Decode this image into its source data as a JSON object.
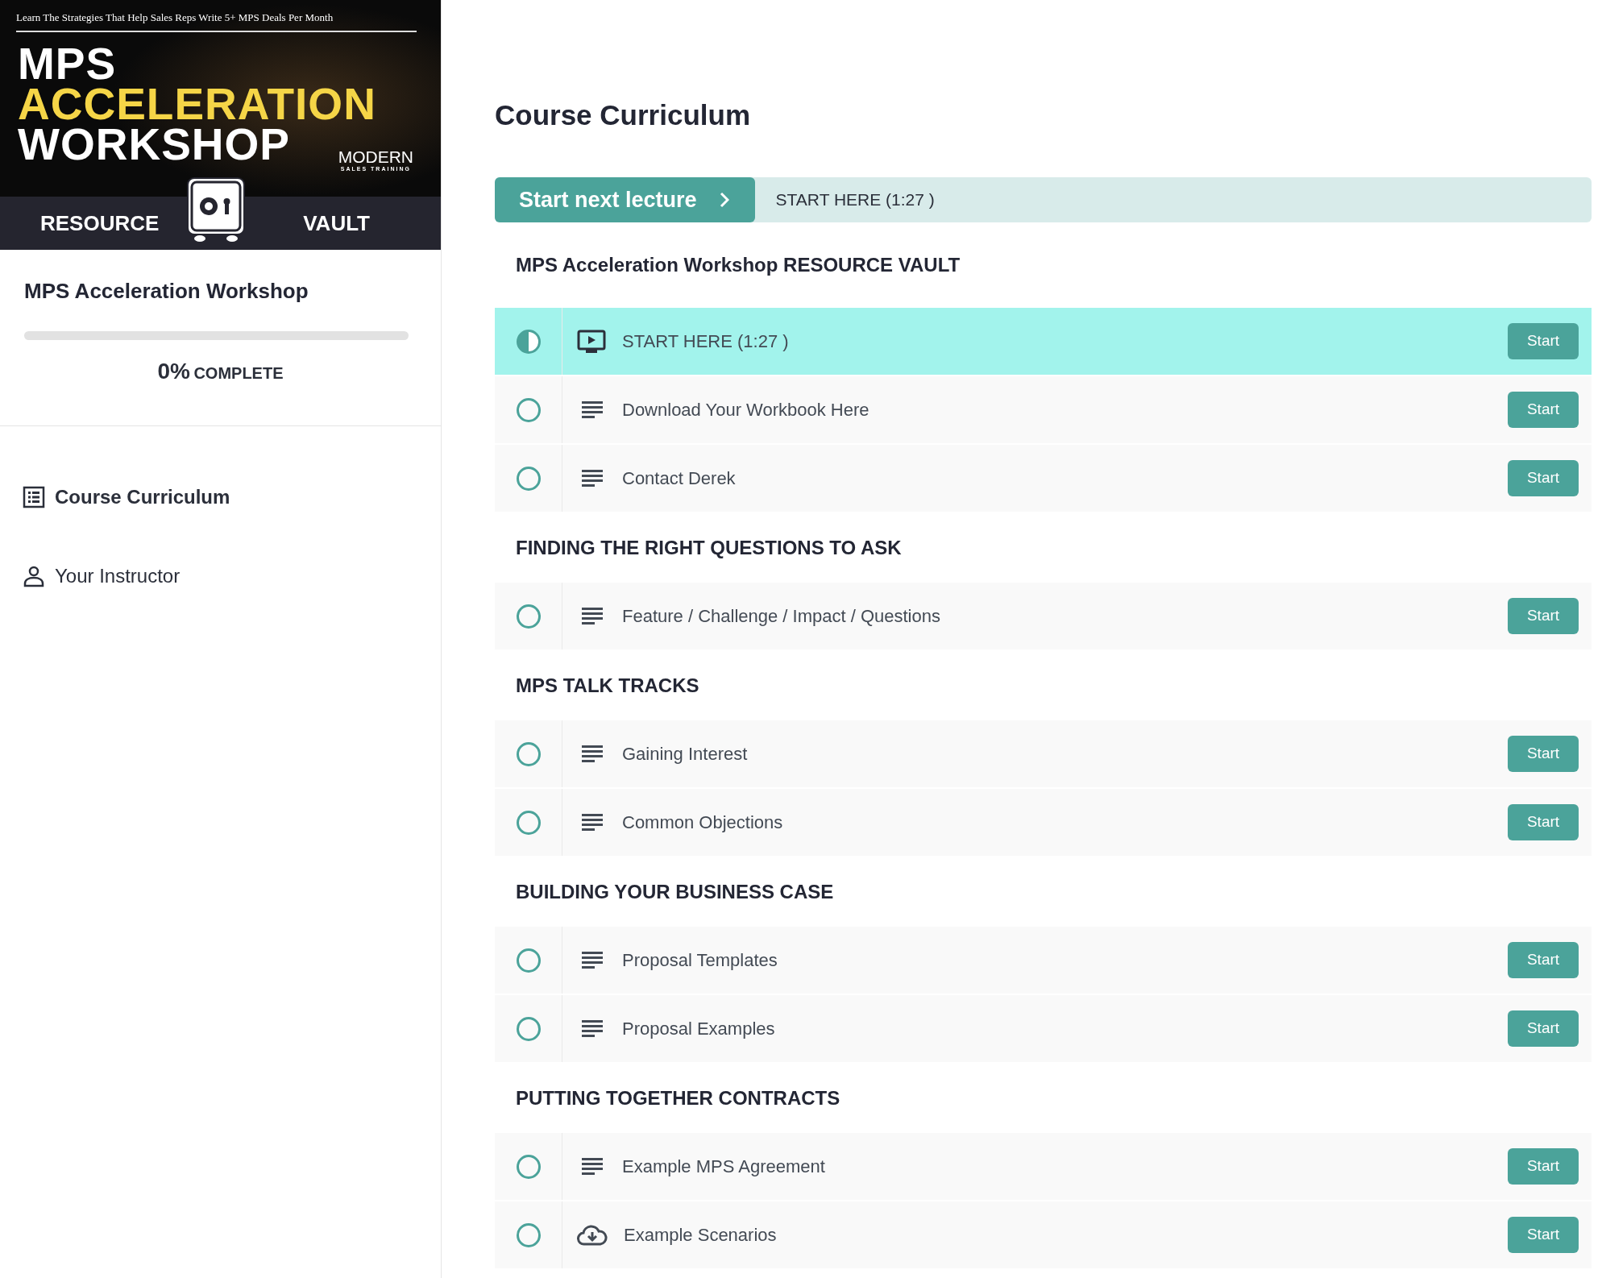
{
  "banner": {
    "tagline": "Learn The Strategies That Help Sales Reps Write 5+ MPS Deals Per Month",
    "title_lines": [
      {
        "text": "MPS",
        "color": "#ffffff"
      },
      {
        "text": "ACCELERATION",
        "color": "#f5d547"
      },
      {
        "text": "WORKSHOP",
        "color": "#ffffff"
      }
    ],
    "brand": "MODERN",
    "brand_sub": "SALES TRAINING",
    "left_word": "RESOURCE",
    "right_word": "VAULT"
  },
  "sidebar": {
    "course_title": "MPS Acceleration Workshop",
    "progress": {
      "level": 0,
      "percent": "0%",
      "label": "COMPLETE"
    },
    "items": [
      {
        "label": "Course Curriculum",
        "kind": "curriculum",
        "selected": true
      },
      {
        "label": "Your Instructor",
        "kind": "instructor",
        "selected": false
      }
    ]
  },
  "main": {
    "title": "Course Curriculum",
    "next_button": "Start next lecture",
    "next_lecture": "START HERE (1:27 )",
    "sections": [
      {
        "title": "MPS Acceleration Workshop RESOURCE VAULT",
        "lectures": [
          {
            "title": "START HERE (1:27 )",
            "kind": "video",
            "started": true,
            "selected": true,
            "button": "Start"
          },
          {
            "title": "Download Your Workbook Here",
            "kind": "text",
            "started": false,
            "selected": false,
            "button": "Start"
          },
          {
            "title": "Contact Derek",
            "kind": "text",
            "started": false,
            "selected": false,
            "button": "Start"
          }
        ]
      },
      {
        "title": "FINDING THE RIGHT QUESTIONS TO ASK",
        "lectures": [
          {
            "title": "Feature / Challenge / Impact / Questions",
            "kind": "text",
            "started": false,
            "selected": false,
            "button": "Start"
          }
        ]
      },
      {
        "title": "MPS TALK TRACKS",
        "lectures": [
          {
            "title": "Gaining Interest",
            "kind": "text",
            "started": false,
            "selected": false,
            "button": "Start"
          },
          {
            "title": "Common Objections",
            "kind": "text",
            "started": false,
            "selected": false,
            "button": "Start"
          }
        ]
      },
      {
        "title": "BUILDING YOUR BUSINESS CASE",
        "lectures": [
          {
            "title": "Proposal Templates",
            "kind": "text",
            "started": false,
            "selected": false,
            "button": "Start"
          },
          {
            "title": "Proposal Examples",
            "kind": "text",
            "started": false,
            "selected": false,
            "button": "Start"
          }
        ]
      },
      {
        "title": "PUTTING TOGETHER CONTRACTS",
        "lectures": [
          {
            "title": "Example MPS Agreement",
            "kind": "text",
            "started": false,
            "selected": false,
            "button": "Start"
          },
          {
            "title": "Example Scenarios",
            "kind": "download",
            "started": false,
            "selected": false,
            "button": "Start"
          }
        ]
      }
    ]
  }
}
